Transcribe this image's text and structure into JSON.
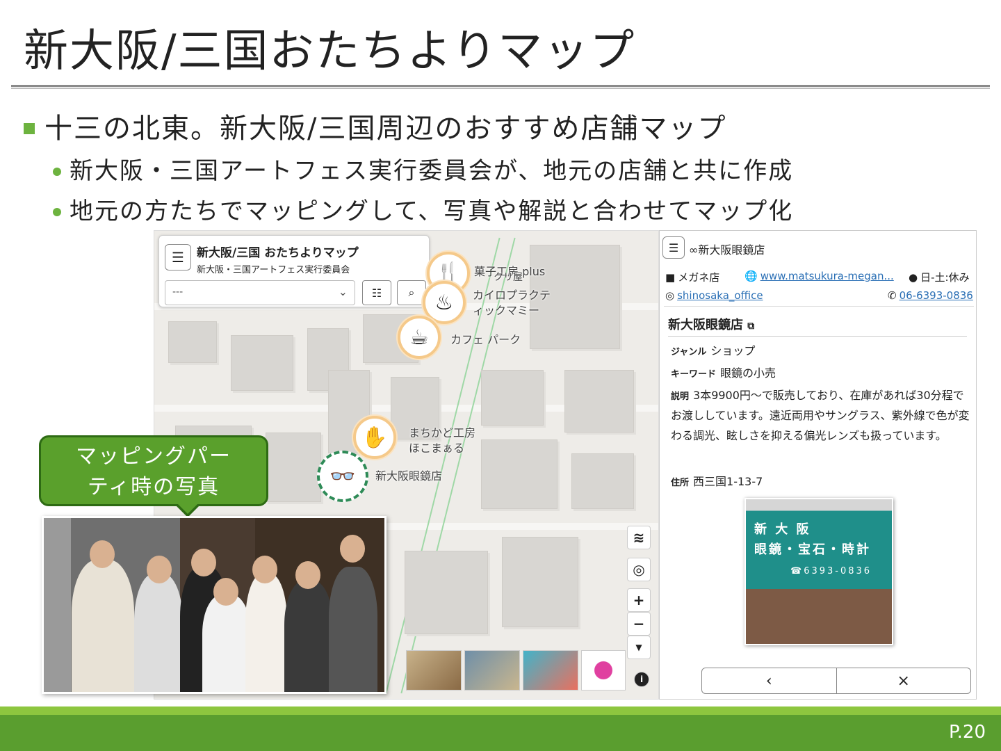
{
  "slide": {
    "title": "新大阪/三国おたちよりマップ",
    "bullet_main": "十三の北東。新大阪/三国周辺のおすすめ店舗マップ",
    "sub_bullets": [
      "新大阪・三国アートフェス実行委員会が、地元の店舗と共に作成",
      "地元の方たちでマッピングして、写真や解説と合わせてマップ化"
    ],
    "callout": [
      "マッピングパー",
      "ティ時の写真"
    ],
    "page_number": "P.20"
  },
  "map": {
    "title": "新大阪/三国 おたちよりマップ",
    "subtitle": "新大阪・三国アートフェス実行委員会",
    "select_value": "---",
    "pois": [
      {
        "label": "菓子工房 plus",
        "icon": "fork-knife-icon"
      },
      {
        "label": "クリ屋",
        "icon": "none"
      },
      {
        "label": "カイロプラクテ\nィックマミー",
        "icon": "massage-icon"
      },
      {
        "label": "カフェ パーク",
        "icon": "coffee-icon"
      },
      {
        "label": "まちかど工房\nほこまぁる",
        "icon": "hand-icon"
      },
      {
        "label": "新大阪眼鏡店",
        "icon": "glasses-icon"
      }
    ]
  },
  "panel": {
    "header_name": "∞新大阪眼鏡店",
    "category": "メガネ店",
    "website": "www.matsukura-megan...",
    "hours": "日-土:休み",
    "instagram": "shinosaka_office",
    "phone": "06-6393-0836",
    "detail_title": "新大阪眼鏡店",
    "genre_label": "ジャンル",
    "genre": "ショップ",
    "keyword_label": "キーワード",
    "keyword": "眼鏡の小売",
    "desc_label": "説明",
    "description": "3本9900円～で販売しており、在庫があれば30分程でお渡ししています。遠近両用やサングラス、紫外線で色が変わる調光、眩しさを抑える偏光レンズも扱っています。",
    "address_label": "住所",
    "address": "西三国1-13-7",
    "store_sign": [
      "新 大 阪",
      "眼鏡・宝石・時計"
    ],
    "store_phone": "☎6393-0836"
  },
  "colors": {
    "accent_green": "#6db33f",
    "footer_green": "#5a9e2f",
    "link_blue": "#2a6fb5"
  }
}
